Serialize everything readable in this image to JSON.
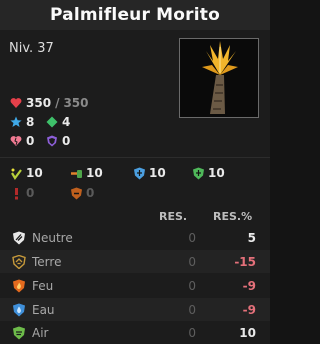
{
  "title": "Palmifleur Morito",
  "level": "Niv. 37",
  "stats": {
    "hp": "350",
    "hp_sep": "/",
    "hp_max": "350",
    "ap": "8",
    "mp": "4",
    "erosion": "0",
    "shield": "0"
  },
  "damage_stats": {
    "row1": [
      "10",
      "10",
      "10",
      "10"
    ],
    "row2": [
      "0",
      "0"
    ]
  },
  "resist_table": {
    "col_res": "RES.",
    "col_pct": "RES.%",
    "rows": [
      {
        "name": "Neutre",
        "res": "0",
        "pct": "5"
      },
      {
        "name": "Terre",
        "res": "0",
        "pct": "-15"
      },
      {
        "name": "Feu",
        "res": "0",
        "pct": "-9"
      },
      {
        "name": "Eau",
        "res": "0",
        "pct": "-9"
      },
      {
        "name": "Air",
        "res": "0",
        "pct": "10"
      }
    ]
  },
  "colors": {
    "negative": "#e4707a",
    "heart": "#e5404a",
    "ap_star": "#3fa9e8",
    "mp_diamond": "#3ec06a",
    "shield": "#8d5fd9"
  }
}
